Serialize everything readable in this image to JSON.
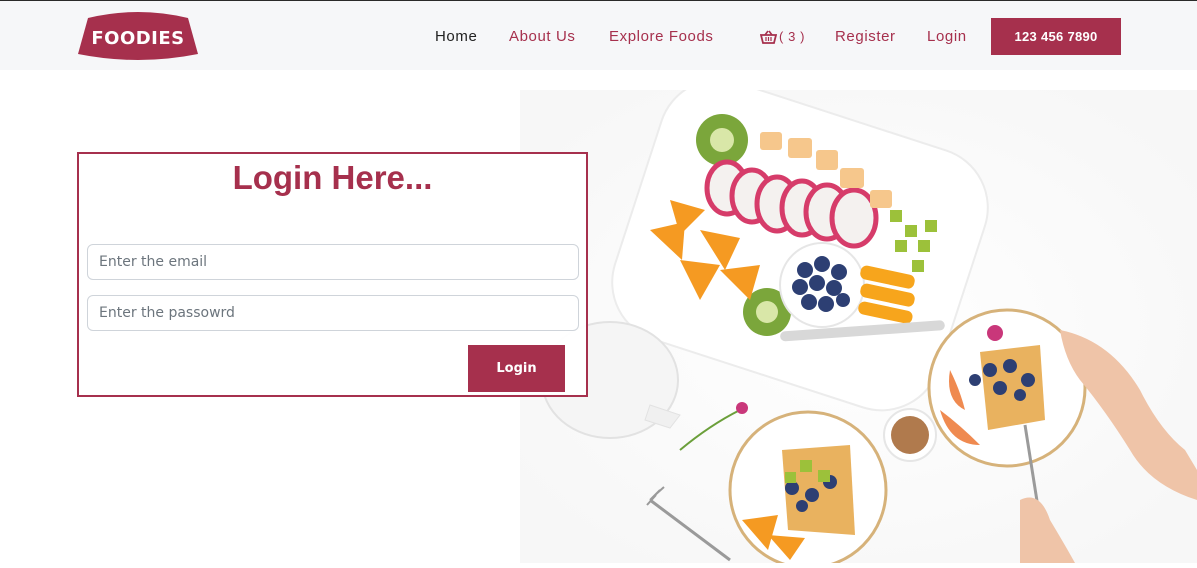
{
  "brand": {
    "name": "FOODIES",
    "color": "#a6304d"
  },
  "nav": {
    "home": "Home",
    "about": "About Us",
    "explore": "Explore Foods",
    "cart_icon": "basket-icon",
    "cart_count": "( 3 )",
    "register": "Register",
    "login": "Login",
    "phone": "123 456 7890"
  },
  "login_form": {
    "title": "Login Here...",
    "email_placeholder": "Enter the email",
    "password_placeholder": "Enter the passowrd",
    "submit_label": "Login"
  },
  "hero": {
    "image": "breakfast-table-photo"
  }
}
